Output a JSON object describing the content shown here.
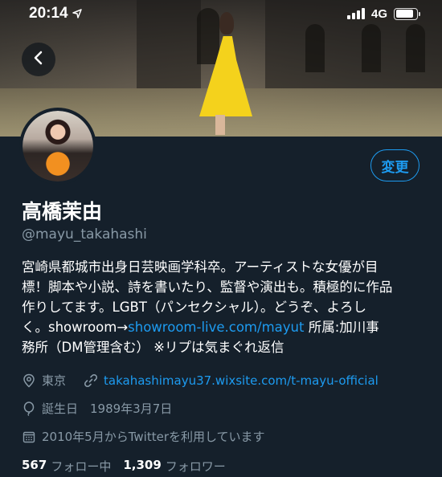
{
  "status_bar": {
    "time": "20:14",
    "network": "4G"
  },
  "profile": {
    "display_name": "高橋茉由",
    "handle": "@mayu_takahashi",
    "edit_label": "変更",
    "bio": {
      "line1": "宮崎県都城市出身日芸映画学科卒。アーティストな女優が目",
      "line2": "標！脚本や小説、詩を書いたり、監督や演出も。積極的に作品",
      "line3": "作りしてます。LGBT（パンセクシャル）。どうぞ、よろし",
      "line4_prefix": "く。showroom→",
      "line4_link": "showroom-live.com/mayut",
      "line4_suffix": " 所属:加川事",
      "line5": "務所（DM管理含む） ※リプは気まぐれ返信"
    },
    "location": "東京",
    "website": "takahashimayu37.wixsite.com/t-mayu-official",
    "birthday": "誕生日　1989年3月7日",
    "joined": "2010年5月からTwitterを利用しています",
    "following_count": "567",
    "following_label": "フォロー中",
    "followers_count": "1,309",
    "followers_label": "フォロワー"
  },
  "colors": {
    "background": "#15202b",
    "accent": "#1d9bf0",
    "secondary_text": "#8899a6"
  },
  "icons": [
    "location-arrow-icon",
    "signal-icon",
    "battery-icon",
    "back-arrow-icon",
    "location-pin-icon",
    "link-icon",
    "balloon-icon",
    "calendar-icon"
  ]
}
